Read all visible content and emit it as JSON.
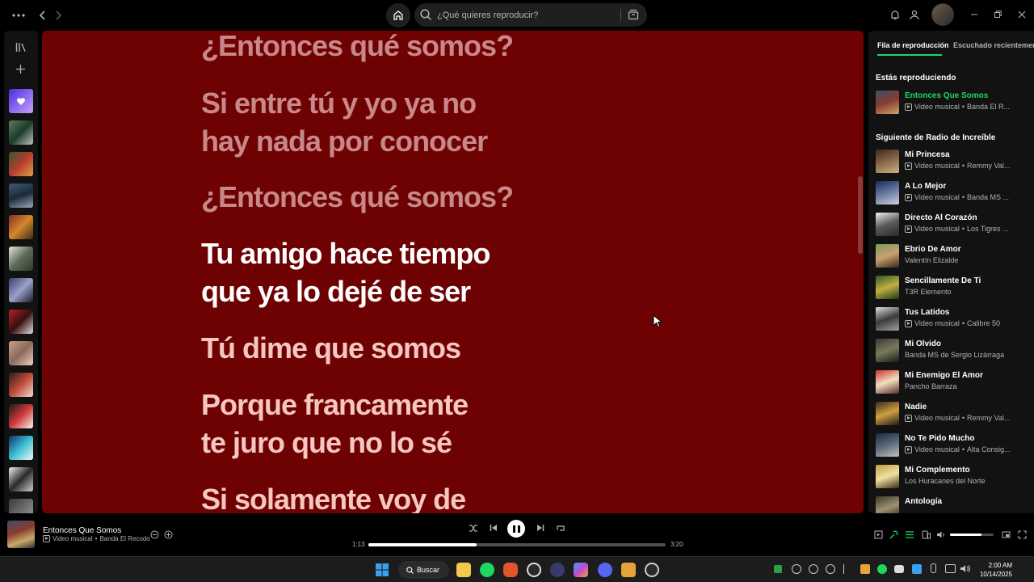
{
  "topbar": {
    "search_placeholder": "¿Qué quieres reproducir?",
    "icons": [
      "more-icon",
      "back-icon",
      "forward-icon",
      "home-icon",
      "search-icon",
      "browse-icon",
      "bell-icon",
      "friends-icon",
      "minimize-icon",
      "maximize-icon",
      "close-icon"
    ]
  },
  "lyrics": {
    "lines": [
      {
        "text": "¿Entonces qué somos?",
        "state": "past"
      },
      {
        "text": "Si entre tú y yo ya no",
        "state": "past"
      },
      {
        "text": "hay nada por conocer",
        "state": "past"
      },
      {
        "text": "¿Entonces qué somos?",
        "state": "past"
      },
      {
        "text": "Tu amigo hace tiempo",
        "state": "active"
      },
      {
        "text": "que ya lo dejé de ser",
        "state": "active"
      },
      {
        "text": "Tú dime que somos",
        "state": "future"
      },
      {
        "text": "Porque francamente",
        "state": "future"
      },
      {
        "text": "te juro que no lo sé",
        "state": "future"
      },
      {
        "text": "Si solamente voy de",
        "state": "future"
      }
    ],
    "colors": {
      "background": "#6e0202",
      "past": "#c8888a",
      "active": "#ffffff",
      "future": "#f6c6c0"
    }
  },
  "queue": {
    "tabs": [
      {
        "label": "Fila de reproducción",
        "active": true
      },
      {
        "label": "Escuchado recientemente",
        "active": false
      }
    ],
    "now_playing_heading": "Estás reproduciendo",
    "now_playing": {
      "title": "Entonces Que Somos",
      "type": "Video musical",
      "artist": "Banda El R...",
      "video": true
    },
    "next_heading": "Siguiente de Radio de Increíble",
    "items": [
      {
        "title": "Mi Princesa",
        "type": "Video musical",
        "artist": "Remmy Val...",
        "video": true
      },
      {
        "title": "A Lo Mejor",
        "type": "Video musical",
        "artist": "Banda MS ...",
        "video": true
      },
      {
        "title": "Directo Al Corazón",
        "type": "Video musical",
        "artist": "Los Tigres ...",
        "video": true
      },
      {
        "title": "Ebrio De Amor",
        "type": "",
        "artist": "Valentín Elizalde",
        "video": false
      },
      {
        "title": "Sencillamente De Ti",
        "type": "",
        "artist": "T3R Elemento",
        "video": false
      },
      {
        "title": "Tus Latidos",
        "type": "Video musical",
        "artist": "Calibre 50",
        "video": true
      },
      {
        "title": "Mi Olvido",
        "type": "",
        "artist": "Banda MS de Sergio Lizárraga",
        "video": false
      },
      {
        "title": "Mi Enemigo El Amor",
        "type": "",
        "artist": "Pancho Barraza",
        "video": false
      },
      {
        "title": "Nadie",
        "type": "Video musical",
        "artist": "Remmy Val...",
        "video": true
      },
      {
        "title": "No Te Pido Mucho",
        "type": "Video musical",
        "artist": "Alta Consig...",
        "video": true
      },
      {
        "title": "Mi Complemento",
        "type": "",
        "artist": "Los Huracanes del Norte",
        "video": false
      },
      {
        "title": "Antología",
        "type": "",
        "artist": "",
        "video": false
      }
    ]
  },
  "player": {
    "title": "Entonces Que Somos",
    "type": "Video musical",
    "artist": "Banda El Recodo",
    "elapsed": "1:13",
    "duration": "3:20",
    "progress_fraction": 0.365,
    "volume_fraction": 0.72,
    "accent": "#1ed760"
  },
  "taskbar": {
    "search_label": "Buscar",
    "time": "2:00 AM",
    "date": "10/14/2025"
  }
}
